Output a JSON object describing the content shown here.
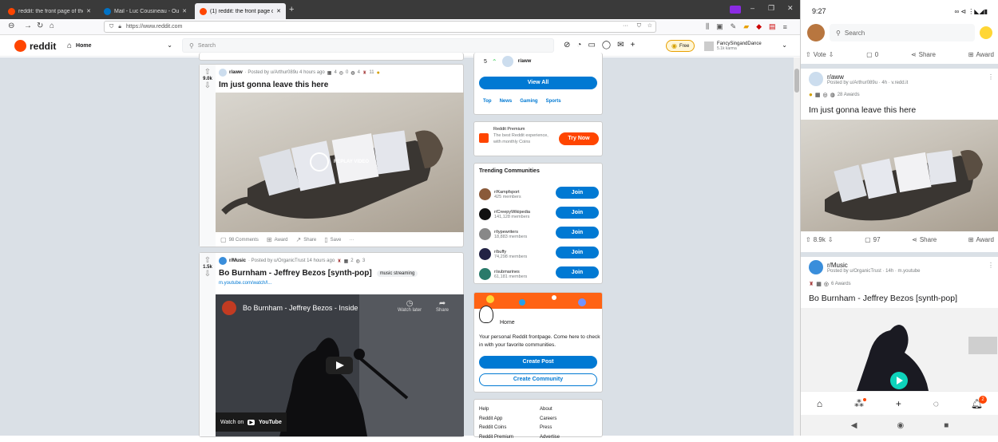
{
  "browser": {
    "tabs": [
      {
        "label": "reddit: the front page of the in",
        "color": "#ff4500"
      },
      {
        "label": "Mail - Luc Cousineau - Outlook",
        "color": "#0072c6"
      },
      {
        "label": "(1) reddit: the front page of the",
        "color": "#ff4500"
      }
    ],
    "url": "https://www.reddit.com"
  },
  "reddit_header": {
    "logo": "reddit",
    "home_label": "Home",
    "search_placeholder": "Search",
    "free_label": "Free",
    "username": "FancySingandDance",
    "karma": "5.1k karma"
  },
  "posts": [
    {
      "score": "9.0k",
      "subreddit": "r/aww",
      "meta": "· Posted by u/Arthur089u 4 hours ago",
      "award_counts": [
        "4",
        "0",
        "4",
        "11"
      ],
      "title": "Im just gonna leave this here",
      "replay_label": "REPLAY VIDEO",
      "actions": [
        "98 Comments",
        "Award",
        "Share",
        "Save",
        "···"
      ]
    },
    {
      "score": "1.5k",
      "subreddit": "r/Music",
      "meta": "· Posted by u/OrganicTrust 14 hours ago",
      "award_counts": [
        "2",
        "3"
      ],
      "title": "Bo Burnham - Jeffrey Bezos [synth-pop]",
      "flair": "music streaming",
      "link": "m.youtube.com/watch/l...",
      "video_title": "Bo Burnham - Jeffrey Bezos - Inside",
      "watch_later": "Watch later",
      "share": "Share",
      "watch_on": "Watch on",
      "youtube": "YouTube"
    }
  ],
  "sidebar": {
    "top_rank": "5",
    "top_sub": "r/aww",
    "view_all": "View All",
    "filters": [
      "Top",
      "News",
      "Gaming",
      "Sports"
    ],
    "premium": {
      "title": "Reddit Premium",
      "desc": "The best Reddit experience, with monthly Coins",
      "button": "Try Now"
    },
    "trending_title": "Trending Communities",
    "communities": [
      {
        "name": "r/Kampfsport",
        "members": "425 members",
        "join": "Join",
        "color": "#8a5a3a"
      },
      {
        "name": "r/CreepyWikipedia",
        "members": "141,128 members",
        "join": "Join",
        "color": "#111111"
      },
      {
        "name": "r/typewriters",
        "members": "18,883 members",
        "join": "Join",
        "color": "#888888"
      },
      {
        "name": "r/buffy",
        "members": "74,298 members",
        "join": "Join",
        "color": "#222244"
      },
      {
        "name": "r/submarines",
        "members": "61,181 members",
        "join": "Join",
        "color": "#2a7a6a"
      }
    ],
    "home_card": {
      "title": "Home",
      "desc": "Your personal Reddit frontpage. Come here to check in with your favorite communities.",
      "create_post": "Create Post",
      "create_community": "Create Community"
    },
    "footer": {
      "left": [
        "Help",
        "Reddit App",
        "Reddit Coins",
        "Reddit Premium"
      ],
      "right": [
        "About",
        "Careers",
        "Press",
        "Advertise"
      ]
    }
  },
  "phone": {
    "time": "9:27",
    "search_placeholder": "Search",
    "top_actions": {
      "vote": "Vote",
      "comments": "0",
      "share": "Share",
      "award": "Award"
    },
    "posts": [
      {
        "subreddit": "r/aww",
        "meta": "Posted by u/Arthur089u · 4h · v.redd.it",
        "awards": "28 Awards",
        "title": "Im just gonna leave this here",
        "score": "8.9k",
        "comments": "97",
        "share": "Share",
        "award": "Award"
      },
      {
        "subreddit": "r/Music",
        "meta": "Posted by u/OrganicTrust · 14h · m.youtube",
        "awards": "6 Awards",
        "title": "Bo Burnham - Jeffrey Bezos [synth-pop]"
      }
    ],
    "notification_badge": "2"
  }
}
